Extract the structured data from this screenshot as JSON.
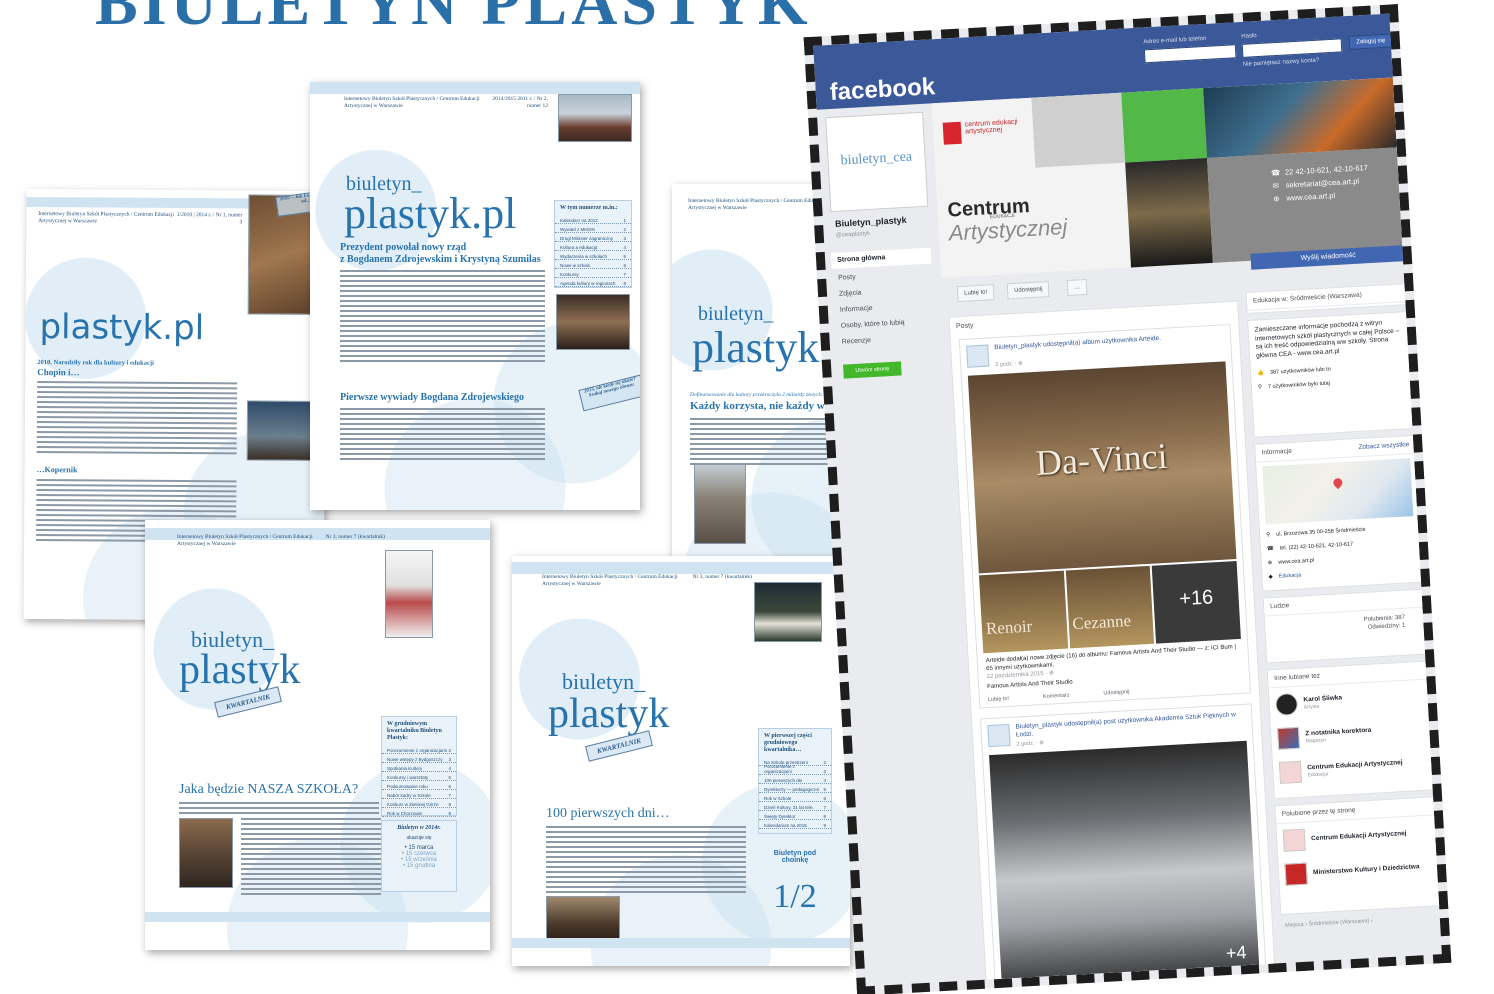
{
  "heading": "BIULETYN PLASTYK",
  "newsletters": {
    "p1": {
      "issuer": "Internetowy Biuletyn Szkół Plastycznych / Centrum Edukacji Artystycznej w Warszawie",
      "issue": "1/2010 | 2014 r. / Nr 1, numer 3",
      "logo": "plastyk.pl",
      "headline1": "2010. Narodziły rok dla kultury i edukacji",
      "headline1b": "Chopin i…",
      "headline2": "…Kopernik",
      "caption": "2010 – Jak Fo… w Lecie od…"
    },
    "p2": {
      "issuer": "Internetowy Biuletyn Szkół Plastycznych / Centrum Edukacji Artystycznej w Warszawie",
      "issue": "2014/2015 2011 r. / Nr 2, numer 12",
      "logo_small": "biuletyn_",
      "logo_big": "plastyk.pl",
      "headline1": "Prezydent powołał nowy rząd",
      "headline1b": "z Bogdanem Zdrojewskim i Krystyną Szumilas",
      "headline2": "Pierwsze wywiady Bogdana Zdrojewskiego",
      "toc_title": "W tym numerze m.in.:",
      "toc_rows": [
        "Kalendarz na 2012",
        "Wywiad z MKiDN",
        "Drugi Minister zagraniczny",
        "Kultura a edukacja",
        "Wydarzenia w szkołach",
        "Nowe w szkole",
        "Konkursy",
        "Agenda kultury w regionach"
      ],
      "stamp": "2013, ale kiedy się ukaże? Szukaj nowego obrazu"
    },
    "p3": {
      "issuer": "Internetowy Biuletyn Szkół Plastycznych / Centrum Edukacji Artystycznej w Warszawie",
      "logo_small": "biuletyn_",
      "logo_big": "plastyk",
      "headline0": "Dofinansowanie dla kultury przekroczyło 2 miliardy złotych…",
      "headline1": "Każdy korzysta, nie każdy widzi"
    },
    "p4": {
      "issuer": "Internetowy Biuletyn Szkół Plastycznych / Centrum Edukacji Artystycznej w Warszawie",
      "issue": "Nr 3, numer 7 (kwartalnik)",
      "logo_small": "biuletyn_",
      "logo_big": "plastyk",
      "stamp": "KWARTALNIK",
      "headline1": "Jaka będzie NASZA SZKOŁA?",
      "toc_title": "W grudniowym kwartalniku Biuletyn Plastyk:",
      "toc_rows": [
        "Porozumienie z organizacjami",
        "Nowe wstępy z Bydgoszczy",
        "Spotkania Kultury",
        "Konkursy i warsztaty",
        "Podsumowanie roku",
        "Nabór kadry w Szkole",
        "Konkurs w Zielonej Górze",
        "Rok w Chorzowie"
      ],
      "box_title": "Biuletyn w 2014r.",
      "box_sub": "ukazuje się",
      "box_rows": [
        "• 15 marca",
        "• 15 czerwca",
        "• 15 września",
        "• 15 grudnia"
      ]
    },
    "p5": {
      "issuer": "Internetowy Biuletyn Szkół Plastycznych / Centrum Edukacji Artystycznej w Warszawie",
      "issue": "Nr 3, numer 7 (kwartalnik)",
      "logo_small": "biuletyn_",
      "logo_big": "plastyk",
      "stamp": "KWARTALNIK",
      "headline1": "100 pierwszych dni…",
      "toc_title": "W pierwszej części grudniowego kwartalnika…",
      "toc_rows": [
        "Na Szkole przestrzeni",
        "Porozumienie z organizacjami",
        "100 pierwszych dni",
        "Dyrektorzy — pedagogiczni",
        "Rok w Szkole",
        "Dzień Kultury, 31 lat tele.",
        "Święty Dyrektor",
        "Kalendarium na 2015"
      ],
      "box_title": "Biuletyn pod choinkę",
      "box_big": "1/2"
    }
  },
  "facebook": {
    "brand": "facebook",
    "top_labels": [
      "Adres e-mail lub telefon",
      "Hasło",
      "Nie pamiętasz nazwy konta?"
    ],
    "login_button": "Zaloguj się",
    "profile_label": "biuletyn_cea",
    "page_name": "Biuletyn_plastyk",
    "handle": "@ceaplastyk",
    "nav": [
      "Strona główna",
      "Posty",
      "Zdjęcia",
      "Informacje",
      "Osoby, które to lubią",
      "Recenzje"
    ],
    "create_page": "Utwórz stronę",
    "cover": {
      "mini_logo": "centrum edukacji artystycznej",
      "cea_line1": "Centrum",
      "cea_edu": "EDUKACJI",
      "cea_line2": "Artystycznej",
      "contacts": [
        {
          "icon": "phone-icon",
          "glyph": "☎",
          "text": "22 42-10-621, 42-10-617"
        },
        {
          "icon": "mail-icon",
          "glyph": "✉",
          "text": "sekretariat@cea.art.pl"
        },
        {
          "icon": "globe-icon",
          "glyph": "⊕",
          "text": "www.cea.art.pl"
        }
      ]
    },
    "send_message": "Wyślij wiadomość",
    "actions": [
      "Lubię to!",
      "Udostępnij",
      "…"
    ],
    "feed_title": "Posty",
    "post1": {
      "header": "Biuletyn_plastyk udostępnił(a) album użytkownika Arteide.",
      "time": "2 godz. · ⊕",
      "image_title": "Da-Vinci",
      "thumbs": [
        "Renoir",
        "Cezanne",
        "+16"
      ],
      "caption": "Arteide dodał(a) nowe zdjęcie (16) do albumu: Famous Artists And Their Studio — z: ICI Bum | 65 innymi użytkownikami.",
      "date": "22 października 2015 · ⊕",
      "caption2": "Famous Artists And Their Studio",
      "foot": [
        "Lubię to!",
        "Komentarz",
        "Udostępnij"
      ]
    },
    "post2": {
      "header": "Biuletyn_plastyk udostępnił(a) post użytkownika Akademia Sztuk Pięknych w Łodzi.",
      "time": "2 godz. · ⊕",
      "more": "+4"
    },
    "right": {
      "category": "Edukacja w: Śródmieście (Warszawa)",
      "about": "Zamieszczane informacje pochodzą z witryn internetowych szkół plastycznych w całej Polsce – są ich treść odpowiedzialną ww szkoły. Strona główna CEA - www.cea.art.pl",
      "likes": "387 użytkowników lubi to",
      "visits": "7 użytkowników było tutaj",
      "info_title": "Informacje",
      "suggest": "Zobacz wszystkie",
      "address": "ul. Brzozowa 35 00-258 Śródmieście",
      "phone": "tel. (22) 42-10-621, 42-10-617",
      "web": "www.cea.art.pl",
      "cat2": "Edukacja",
      "people_title": "Ludzie",
      "people_likes": "Polubienia: 387",
      "people_visits": "Odwiedziny: 1",
      "liked_title": "Inne lubiane też",
      "liked": [
        {
          "name": "Karol Śliwka",
          "cat": "Artysta"
        },
        {
          "name": "Z notatnika korektora",
          "cat": "Magazyn"
        },
        {
          "name": "Centrum Edukacji Artystycznej",
          "cat": "Edukacja"
        }
      ],
      "liked_by_title": "Polubione przez tę stronę",
      "liked_by": [
        "Centrum Edukacji Artystycznej",
        "Ministerstwo Kultury i Dziedzictwa"
      ],
      "footer": "Miejsca › Śródmieście (Warszawa) ›"
    }
  }
}
